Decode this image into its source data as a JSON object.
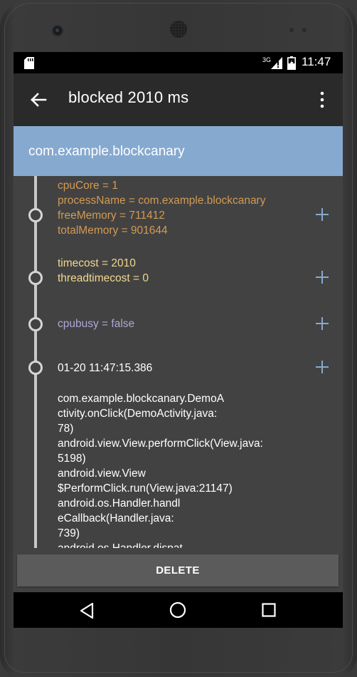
{
  "status_bar": {
    "network": "3G",
    "time": "11:47"
  },
  "app_bar": {
    "title": "blocked 2010 ms",
    "back_icon": "arrow-left-icon",
    "menu_icon": "more-vert-icon"
  },
  "header": {
    "package": "com.example.blockcanary"
  },
  "entries": [
    {
      "lines": [
        "cpuCore = 1",
        "processName = com.example.blockcanary",
        "freeMemory = 711412",
        "totalMemory = 901644"
      ],
      "color": "#d39a54"
    },
    {
      "lines": [
        "timecost = 2010",
        "threadtimecost = 0"
      ],
      "color": "#f2d98e"
    },
    {
      "lines": [
        "cpubusy = false"
      ],
      "color": "#b0a6d6"
    },
    {
      "lines": [
        "01-20 11:47:15.386"
      ],
      "color": "#ffffff"
    }
  ],
  "stack_trace": [
    "com.example.blockcanary.DemoA",
    "ctivity.onClick(DemoActivity.java:",
    "78)",
    "android.view.View.performClick(View.java:",
    "5198)",
    "android.view.View",
    "$PerformClick.run(View.java:21147)",
    "android.os.Handler.handl",
    "eCallback(Handler.java:",
    "739)",
    "android.os.Handler.dispat"
  ],
  "footer": {
    "delete_label": "DELETE"
  },
  "colors": {
    "accent": "#86a9cf",
    "app_bar": "#2a2a2a",
    "background": "#424242"
  }
}
